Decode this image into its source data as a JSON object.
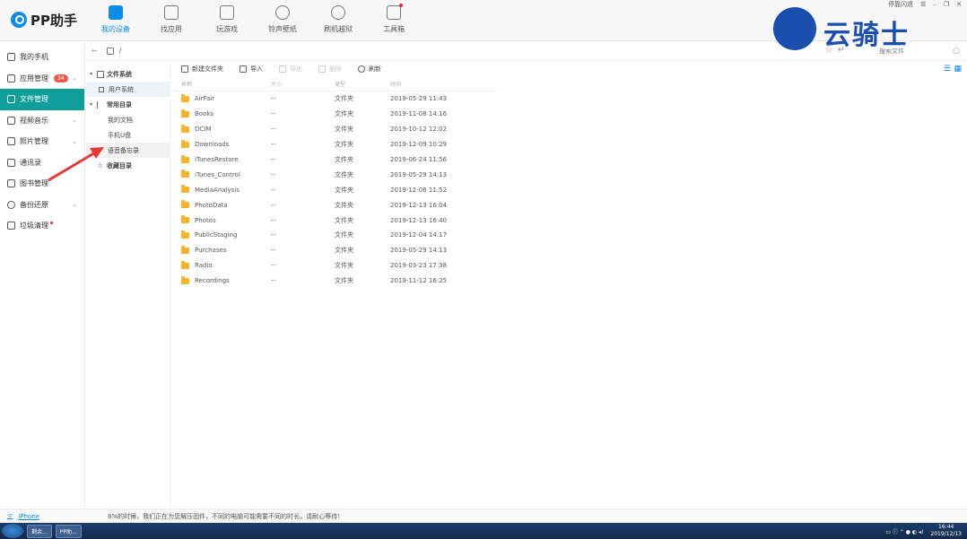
{
  "app": {
    "logo_text": "PP助手"
  },
  "topnav": [
    {
      "label": "我的设备",
      "icon": "phone-icon",
      "active": true
    },
    {
      "label": "找应用",
      "icon": "store-icon"
    },
    {
      "label": "玩游戏",
      "icon": "gamepad-icon"
    },
    {
      "label": "铃声壁纸",
      "icon": "star-icon"
    },
    {
      "label": "刷机越狱",
      "icon": "refresh-icon"
    },
    {
      "label": "工具箱",
      "icon": "toolbox-icon"
    }
  ],
  "window": {
    "pin_label": "停靠闪退",
    "menu": "☰",
    "minimize": "–",
    "restore": "❐",
    "close": "✕"
  },
  "watermark": {
    "text": "云骑士"
  },
  "sidebar": {
    "items": [
      {
        "label": "我的手机"
      },
      {
        "label": "应用管理",
        "badge": "34"
      },
      {
        "label": "文件管理",
        "active": true
      },
      {
        "label": "视频音乐"
      },
      {
        "label": "照片管理"
      },
      {
        "label": "通讯录"
      },
      {
        "label": "图书管理"
      },
      {
        "label": "备份还原"
      },
      {
        "label": "垃圾清理"
      }
    ]
  },
  "pathbar": {
    "path": "/",
    "search_placeholder": "搜索文件"
  },
  "tree": {
    "file_system": "文件系统",
    "user_system": "用户系统",
    "common_dirs": "常用目录",
    "my_docs": "我的文档",
    "phone_udisk": "手机U盘",
    "voice_memo": "语音备忘录",
    "favorites": "收藏目录"
  },
  "toolbar": {
    "new_folder": "新建文件夹",
    "import": "导入",
    "export": "导出",
    "delete": "删除",
    "refresh": "刷新"
  },
  "table": {
    "headers": {
      "name": "名称",
      "size": "大小",
      "type": "类型",
      "time": "时间"
    },
    "rows": [
      {
        "name": "AirFair",
        "size": "--",
        "type": "文件夹",
        "time": "2019-05-29 11:43"
      },
      {
        "name": "Books",
        "size": "--",
        "type": "文件夹",
        "time": "2019-11-08 14:16"
      },
      {
        "name": "DCIM",
        "size": "--",
        "type": "文件夹",
        "time": "2019-10-12 12:02"
      },
      {
        "name": "Downloads",
        "size": "--",
        "type": "文件夹",
        "time": "2019-12-09 10:29"
      },
      {
        "name": "iTunesRestore",
        "size": "--",
        "type": "文件夹",
        "time": "2019-06-24 11:56"
      },
      {
        "name": "iTunes_Control",
        "size": "--",
        "type": "文件夹",
        "time": "2019-05-29 14:13"
      },
      {
        "name": "MediaAnalysis",
        "size": "--",
        "type": "文件夹",
        "time": "2019-12-06 11:52"
      },
      {
        "name": "PhotoData",
        "size": "--",
        "type": "文件夹",
        "time": "2019-12-13 16:04"
      },
      {
        "name": "Photos",
        "size": "--",
        "type": "文件夹",
        "time": "2019-12-13 16:40"
      },
      {
        "name": "PublicStaging",
        "size": "--",
        "type": "文件夹",
        "time": "2019-12-04 14:17"
      },
      {
        "name": "Purchases",
        "size": "--",
        "type": "文件夹",
        "time": "2019-05-29 14:13"
      },
      {
        "name": "Radio",
        "size": "--",
        "type": "文件夹",
        "time": "2019-03-23 17:38"
      },
      {
        "name": "Recordings",
        "size": "--",
        "type": "文件夹",
        "time": "2019-11-12 16:25"
      }
    ]
  },
  "status": {
    "device": "iPhone",
    "message": "8%的时候，我们正在为您解压固件，不同的电脑可能需要不同的时长，请耐心等待！"
  },
  "taskbar": {
    "task1": "剩余...",
    "task2": "PP助...",
    "time": "16:44",
    "date": "2019/12/13"
  },
  "colors": {
    "accent": "#0e8be6",
    "active_side": "#0e9f9a",
    "folder": "#f3b431",
    "annotation": "#e53935"
  }
}
